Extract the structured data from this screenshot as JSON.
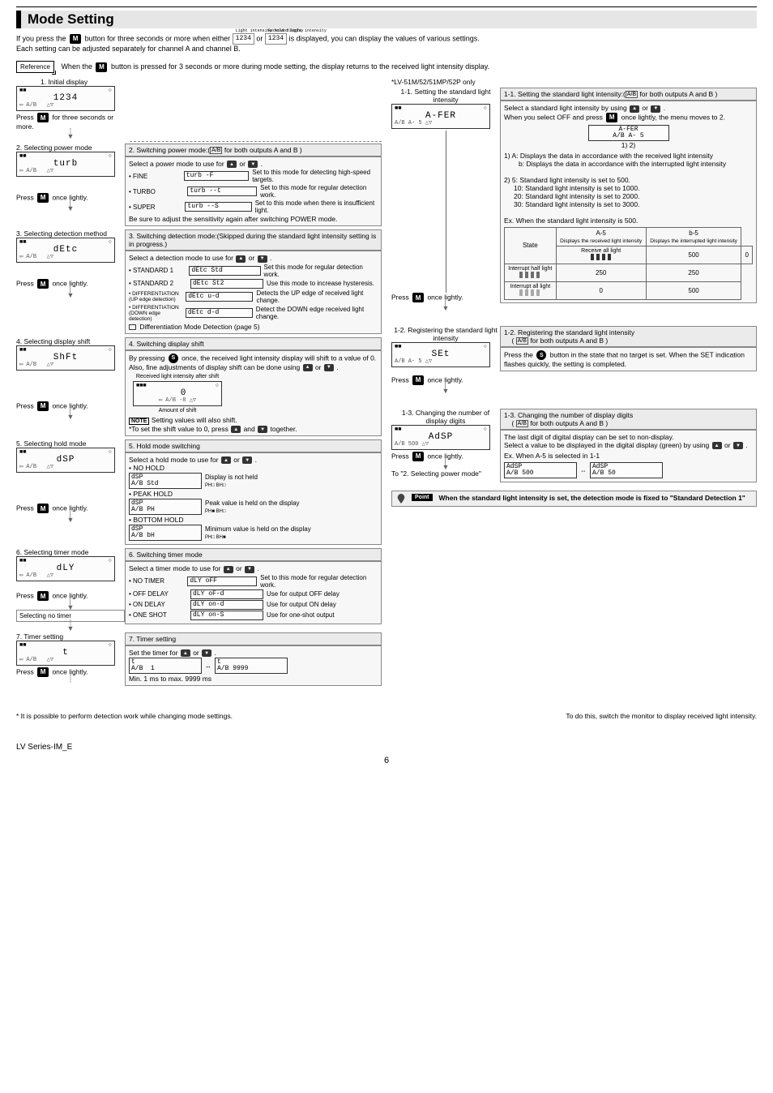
{
  "title": "Mode Setting",
  "intro_line1_a": "If you press the ",
  "intro_line1_b": " button for three seconds or more when either ",
  "intro_line1_c": " or ",
  "intro_line1_d": " is displayed, you can display the values of various settings.",
  "intro_line2": "Each setting can be adjusted separately for channel A and channel B.",
  "seg1_note": "Light intensity hold display",
  "seg1_text": "1234",
  "seg2_note": "Received light intensity",
  "seg2_text": "1234",
  "reference_label": "Reference",
  "reference_text_a": "When the ",
  "reference_text_b": " button is pressed for 3 seconds or more during mode setting, the display returns to the received light intensity display.",
  "step1_label": "1. Initial display",
  "step1_press": "Press ",
  "step1_press_b": " for three seconds or more.",
  "step2_left": "2. Selecting power mode",
  "step2_press": "Press ",
  "step2_press_b": " once lightly.",
  "step2_header": "2. Switching power mode:(",
  "step2_header_b": " for both outputs A and B )",
  "step2_desc": "Select a power mode to use for ",
  "step2_desc_b": " or ",
  "step2_desc_c": " .",
  "step2_fine": "• FINE",
  "step2_fine_txt": "Set to this mode for detecting high-speed targets.",
  "step2_turbo": "• TURBO",
  "step2_turbo_txt": "Set to this mode for regular detection work.",
  "step2_super": "• SUPER",
  "step2_super_txt": "Set to this mode when there is insufficient light.",
  "step2_foot": "Be sure to adjust the sensitivity again after switching POWER mode.",
  "step3_left": "3. Selecting detection method",
  "step3_press": "Press ",
  "step3_press_b": " once lightly.",
  "step3_header": "3. Switching detection mode:(Skipped during the standard light intensity setting is in progress.)",
  "step3_desc": "Select a detection mode to use for ",
  "step3_desc_b": " or ",
  "step3_desc_c": " .",
  "step3_s1": "• STANDARD 1",
  "step3_s1_txt": "Set this mode for regular detection work.",
  "step3_s2": "• STANDARD 2",
  "step3_s2_txt": "Use this mode to increase hysteresis.",
  "step3_d1": "• DIFFERENTIATION",
  "step3_d1_sub": "(UP edge detection)",
  "step3_d1_txt": "Detects the UP edge of received light change.",
  "step3_d2": "• DIFFERENTIATION",
  "step3_d2_sub": "(DOWN edge detection)",
  "step3_d2_txt": "Detect the DOWN edge received light change.",
  "step3_ref": " Differentiation Mode Detection (page 5)",
  "step4_left": "4. Selecting display shift",
  "step4_press": "Press ",
  "step4_press_b": " once lightly.",
  "step4_header": "4. Switching display shift",
  "step4_desc_a": "By pressing ",
  "step4_desc_b": " once, the received light intensity display will shift to a value of 0. Also, fine adjustments of display shift can be done using ",
  "step4_desc_c": " or ",
  "step4_desc_d": " .",
  "step4_rli": "Received light intensity after shift",
  "step4_amt": "Amount of shift",
  "step4_note": " Setting values will also shift.",
  "step4_zero_a": "*To set the shift value to 0, press ",
  "step4_zero_b": " and ",
  "step4_zero_c": " together.",
  "step5_left": "5. Selecting hold mode",
  "step5_press": "Press ",
  "step5_press_b": " once lightly.",
  "step5_header": "5. Hold mode switching",
  "step5_desc": "Select a hold mode to use for ",
  "step5_desc_b": " or ",
  "step5_desc_c": " .",
  "step5_nh": "• NO HOLD",
  "step5_nh_txt": "Display is not held",
  "step5_ph": "• PEAK HOLD",
  "step5_ph_txt": "Peak value is held on the display",
  "step5_bh": "• BOTTOM HOLD",
  "step5_bh_txt": "Minimum value is held on the display",
  "step6_left": "6. Selecting timer mode",
  "step6_press": "Press ",
  "step6_press_b": " once lightly.",
  "step6_sel": "Selecting no timer",
  "step6_header": "6. Switching timer mode",
  "step6_desc": "Select a timer mode to use for ",
  "step6_desc_b": " or ",
  "step6_desc_c": " .",
  "step6_nt": "• NO TIMER",
  "step6_nt_txt": "Set to this mode for regular detection work.",
  "step6_off": "• OFF DELAY",
  "step6_off_txt": "Use for output OFF delay",
  "step6_on": "• ON DELAY",
  "step6_on_txt": "Use for output ON delay",
  "step6_os": "• ONE SHOT",
  "step6_os_txt": "Use for one-shot output",
  "step7_left": "7. Timer setting",
  "step7_press": "Press ",
  "step7_press_b": " once lightly.",
  "step7_header": "7. Timer setting",
  "step7_desc": "Set the timer for ",
  "step7_desc_b": " or ",
  "step7_desc_c": " .",
  "step7_range": "Min. 1 ms to max. 9999 ms",
  "r_only": "*LV-51M/52/51MP/52P only",
  "r11_left_a": "1-1. Setting the standard light intensity",
  "r11_press": "Press ",
  "r11_press_b": " once lightly.",
  "r11_header_a": "1-1. Setting the standard light intensity:(",
  "r11_header_b": " for both outputs A and B )",
  "r11_desc_a": "Select a standard light intensity by using ",
  "r11_desc_b": " or ",
  "r11_desc_c": " .",
  "r11_desc2_a": "When you select OFF and press ",
  "r11_desc2_b": " once lightly, the menu moves to 2.",
  "r11_12": "1)   2)",
  "r11_1a": "1) A: Displays the data in accordance with the received light intensity",
  "r11_1b": "b: Displays the data in accordance with the interrupted light intensity",
  "r11_2": "2) 5: Standard light intensity is set to 500.",
  "r11_10": "10: Standard light intensity is set to 1000.",
  "r11_20": "20: Standard light intensity is set to 2000.",
  "r11_30": "30: Standard light intensity is set to 3000.",
  "r11_ex": "Ex. When the standard light intensity is 500.",
  "r11_th_state": "State",
  "r11_th_a5": "A-5",
  "r11_th_a5_sub": "Displays the received light intensity",
  "r11_th_b5": "b-5",
  "r11_th_b5_sub": "Displays the interrupted light intensity",
  "r11_row1": "Receive all light",
  "r11_row1_a": "500",
  "r11_row1_b": "0",
  "r11_row2": "Interrupt half light",
  "r11_row2_a": "250",
  "r11_row2_b": "250",
  "r11_row3": "Interrupt all light",
  "r11_row3_a": "0",
  "r11_row3_b": "500",
  "r12_left": "1-2. Registering the standard light intensity",
  "r12_press": "Press ",
  "r12_press_b": " once lightly.",
  "r12_header_a": "1-2. Registering the standard light intensity",
  "r12_header_b": "( ",
  "r12_header_c": " for both outputs A and B )",
  "r12_desc_a": "Press the ",
  "r12_desc_b": " button in the state that no target is set. When the SET indication flashes quickly, the setting is completed.",
  "r13_left": "1-3. Changing the number of display digits",
  "r13_press": "Press ",
  "r13_press_b": " once lightly.",
  "r13_header_a": "1-3. Changing the number of display digits",
  "r13_header_b": "( ",
  "r13_header_c": " for both outputs A and B )",
  "r13_desc1": "The last digit of digital display can be set to non-display.",
  "r13_desc2_a": "Select a value to be displayed in the digital display (green) by using ",
  "r13_desc2_b": " or ",
  "r13_desc2_c": " .",
  "r13_ex": "Ex. When A-5 is selected in 1-1",
  "r13_to2": "To \"2. Selecting power mode\"",
  "point_label": "Point",
  "point_text": "When the standard light intensity is set, the detection mode is fixed to \"Standard Detection 1\"",
  "foot_left": "*   It is possible to perform detection work while changing mode settings.",
  "foot_right": "To do this, switch the monitor to display received light intensity.",
  "series": "LV Series-IM_E",
  "pgnum": "6",
  "lcd": {
    "initial": "1234",
    "turb": "turb",
    "dete": "dEtc",
    "shft": "ShFt",
    "dsp": "dSP",
    "dly": "dLY",
    "t": "t",
    "afer": "A-FER",
    "set": "SEt",
    "adsp": "AdSP",
    "adsp500": "500",
    "adsp50": "50",
    "std": "Std",
    "ph": "PH",
    "bh": "bH",
    "off": "oFF",
    "ond": "on-d",
    "ons": "on-S",
    "t1": "1",
    "t9999": "9999",
    "ia5": "A- 5",
    "ia500": "500",
    "i50": "50"
  }
}
